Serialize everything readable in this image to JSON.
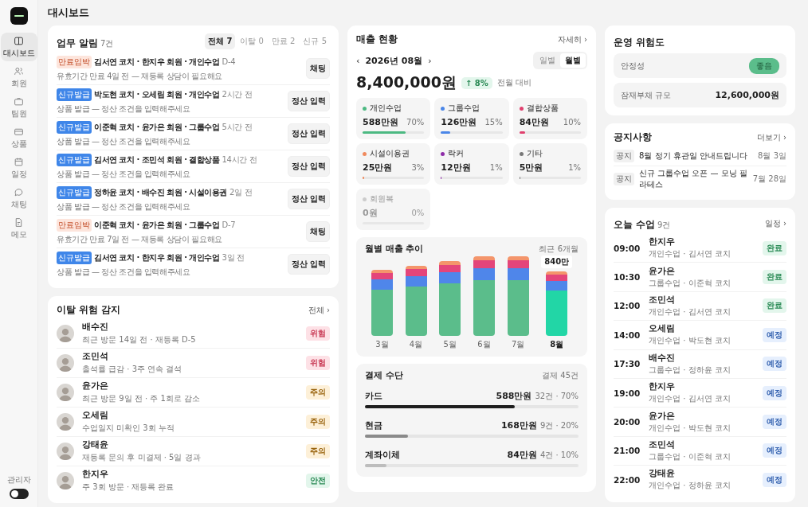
{
  "page_title": "대시보드",
  "sidebar": {
    "items": [
      {
        "label": "대시보드",
        "selected": true
      },
      {
        "label": "회원",
        "selected": false
      },
      {
        "label": "팀원",
        "selected": false
      },
      {
        "label": "상품",
        "selected": false
      },
      {
        "label": "일정",
        "selected": false
      },
      {
        "label": "채팅",
        "selected": false
      },
      {
        "label": "메모",
        "selected": false
      }
    ],
    "admin": {
      "label": "관리자",
      "on": false
    }
  },
  "alerts": {
    "title": "업무 알림",
    "count": "7건",
    "tabs": [
      {
        "label": "전체 7",
        "selected": true
      },
      {
        "label": "이탈 0",
        "selected": false
      },
      {
        "label": "만료 2",
        "selected": false
      },
      {
        "label": "신규 5",
        "selected": false
      }
    ],
    "rows": [
      {
        "kind": "expiring",
        "tag": "만료임박",
        "title": "김서연 코치 · 한지우 회원 · 개인수업",
        "time": "D-4",
        "sub": "유효기간 만료 4일 전 — 재등록 상담이 필요해요",
        "action": "채팅"
      },
      {
        "kind": "new",
        "tag": "신규발급",
        "title": "박도현 코치 · 오세림 회원 · 개인수업",
        "time": "2시간 전",
        "sub": "상품 발급 — 정산 조건을 입력해주세요",
        "action": "정산 입력"
      },
      {
        "kind": "new",
        "tag": "신규발급",
        "title": "이준혁 코치 · 윤가은 회원 · 그룹수업",
        "time": "5시간 전",
        "sub": "상품 발급 — 정산 조건을 입력해주세요",
        "action": "정산 입력"
      },
      {
        "kind": "new",
        "tag": "신규발급",
        "title": "김서연 코치 · 조민석 회원 · 결합상품",
        "time": "14시간 전",
        "sub": "상품 발급 — 정산 조건을 입력해주세요",
        "action": "정산 입력"
      },
      {
        "kind": "new",
        "tag": "신규발급",
        "title": "정하윤 코치 · 배수진 회원 · 시설이용권",
        "time": "2일 전",
        "sub": "상품 발급 — 정산 조건을 입력해주세요",
        "action": "정산 입력"
      },
      {
        "kind": "expiring",
        "tag": "만료임박",
        "title": "이준혁 코치 · 윤가은 회원 · 그룹수업",
        "time": "D-7",
        "sub": "유효기간 만료 7일 전 — 재등록 상담이 필요해요",
        "action": "채팅"
      },
      {
        "kind": "new",
        "tag": "신규발급",
        "title": "김서연 코치 · 한지우 회원 · 개인수업",
        "time": "3일 전",
        "sub": "상품 발급 — 정산 조건을 입력해주세요",
        "action": "정산 입력"
      }
    ]
  },
  "churn": {
    "title": "이탈 위험 감지",
    "link": "전체 ›",
    "rows": [
      {
        "name": "배수진",
        "sub": "최근 방문 14일 전 · 재등록 D-5",
        "kind": "danger",
        "badge": "위험"
      },
      {
        "name": "조민석",
        "sub": "출석률 급감 · 3주 연속 결석",
        "kind": "danger",
        "badge": "위험"
      },
      {
        "name": "윤가은",
        "sub": "최근 방문 9일 전 · 주 1회로 감소",
        "kind": "warn",
        "badge": "주의"
      },
      {
        "name": "오세림",
        "sub": "수업일지 미확인 3회 누적",
        "kind": "warn",
        "badge": "주의"
      },
      {
        "name": "강태윤",
        "sub": "재등록 문의 후 미결제 · 5일 경과",
        "kind": "warn",
        "badge": "주의"
      },
      {
        "name": "한지우",
        "sub": "주 3회 방문 · 재등록 완료",
        "kind": "safe",
        "badge": "안전"
      }
    ]
  },
  "revenue": {
    "title": "매출 현황",
    "link": "자세히 ›",
    "prev": "‹",
    "month": "2026년 08월",
    "next": "›",
    "periods": [
      {
        "label": "일별",
        "selected": false
      },
      {
        "label": "월별",
        "selected": true
      }
    ],
    "total": "8,400,000원",
    "change": "↑ 8%",
    "change_note": "전월 대비",
    "categories": [
      {
        "name": "개인수업",
        "amount": "588만원",
        "pct": "70%",
        "level": 0.7,
        "color": "#4cb982",
        "disabled": false
      },
      {
        "name": "그룹수업",
        "amount": "126만원",
        "pct": "15%",
        "level": 0.15,
        "color": "#4a86e8",
        "disabled": false
      },
      {
        "name": "결합상품",
        "amount": "84만원",
        "pct": "10%",
        "level": 0.1,
        "color": "#e0406e",
        "disabled": false
      },
      {
        "name": "시설이용권",
        "amount": "25만원",
        "pct": "3%",
        "level": 0.03,
        "color": "#f08a5d",
        "disabled": false
      },
      {
        "name": "락커",
        "amount": "12만원",
        "pct": "1%",
        "level": 0.01,
        "color": "#8e2ca8",
        "disabled": false
      },
      {
        "name": "기타",
        "amount": "5만원",
        "pct": "1%",
        "level": 0.01,
        "color": "#777777",
        "disabled": false
      },
      {
        "name": "회원복",
        "amount": "0원",
        "pct": "0%",
        "color": "#cccccc",
        "disabled": true
      }
    ],
    "trend": {
      "title": "월별 매출 추이",
      "note": "최근 6개월",
      "callout": "840만",
      "months": [
        {
          "label": "3월",
          "selected": false
        },
        {
          "label": "4월",
          "selected": false
        },
        {
          "label": "5월",
          "selected": false
        },
        {
          "label": "6월",
          "selected": false
        },
        {
          "label": "7월",
          "selected": false
        },
        {
          "label": "8월",
          "selected": true
        }
      ]
    },
    "payments": {
      "title": "결제 수단",
      "note": "결제 45건",
      "rows": [
        {
          "name": "카드",
          "amount": "588만원",
          "detail": "32건 · 70%",
          "level": 0.7,
          "color": "#1e1e1e"
        },
        {
          "name": "현금",
          "amount": "168만원",
          "detail": "9건 · 20%",
          "level": 0.2,
          "color": "#8a8a8a"
        },
        {
          "name": "계좌이체",
          "amount": "84만원",
          "detail": "4건 · 10%",
          "level": 0.1,
          "color": "#bdbdbd"
        }
      ]
    }
  },
  "risk": {
    "title": "운영 위험도",
    "rows": [
      {
        "kind": "badge",
        "label": "안정성",
        "value": "좋음"
      },
      {
        "kind": "amount",
        "label": "잠재부채 규모",
        "value": "12,600,000원"
      }
    ]
  },
  "notices": {
    "title": "공지사항",
    "link": "더보기 ›",
    "rows": [
      {
        "tag": "공지",
        "text": "8월 정기 휴관일 안내드립니다",
        "date": "8월 3일"
      },
      {
        "tag": "공지",
        "text": "신규 그룹수업 오픈 — 모닝 필라테스",
        "date": "7월 28일"
      }
    ]
  },
  "lessons": {
    "title": "오늘 수업",
    "count": "9건",
    "link": "일정 ›",
    "rows": [
      {
        "time": "09:00",
        "name": "한지우",
        "sub": "개인수업 · 김서연 코치",
        "kind": "done",
        "badge": "완료"
      },
      {
        "time": "10:30",
        "name": "윤가은",
        "sub": "그룹수업 · 이준혁 코치",
        "kind": "done",
        "badge": "완료"
      },
      {
        "time": "12:00",
        "name": "조민석",
        "sub": "개인수업 · 김서연 코치",
        "kind": "done",
        "badge": "완료"
      },
      {
        "time": "14:00",
        "name": "오세림",
        "sub": "개인수업 · 박도현 코치",
        "kind": "scheduled",
        "badge": "예정"
      },
      {
        "time": "17:30",
        "name": "배수진",
        "sub": "그룹수업 · 정하윤 코치",
        "kind": "scheduled",
        "badge": "예정"
      },
      {
        "time": "19:00",
        "name": "한지우",
        "sub": "개인수업 · 김서연 코치",
        "kind": "scheduled",
        "badge": "예정"
      },
      {
        "time": "20:00",
        "name": "윤가은",
        "sub": "개인수업 · 박도현 코치",
        "kind": "scheduled",
        "badge": "예정"
      },
      {
        "time": "21:00",
        "name": "조민석",
        "sub": "그룹수업 · 이준혁 코치",
        "kind": "scheduled",
        "badge": "예정"
      },
      {
        "time": "22:00",
        "name": "강태윤",
        "sub": "개인수업 · 정하윤 코치",
        "kind": "scheduled",
        "badge": "예정"
      }
    ]
  }
}
